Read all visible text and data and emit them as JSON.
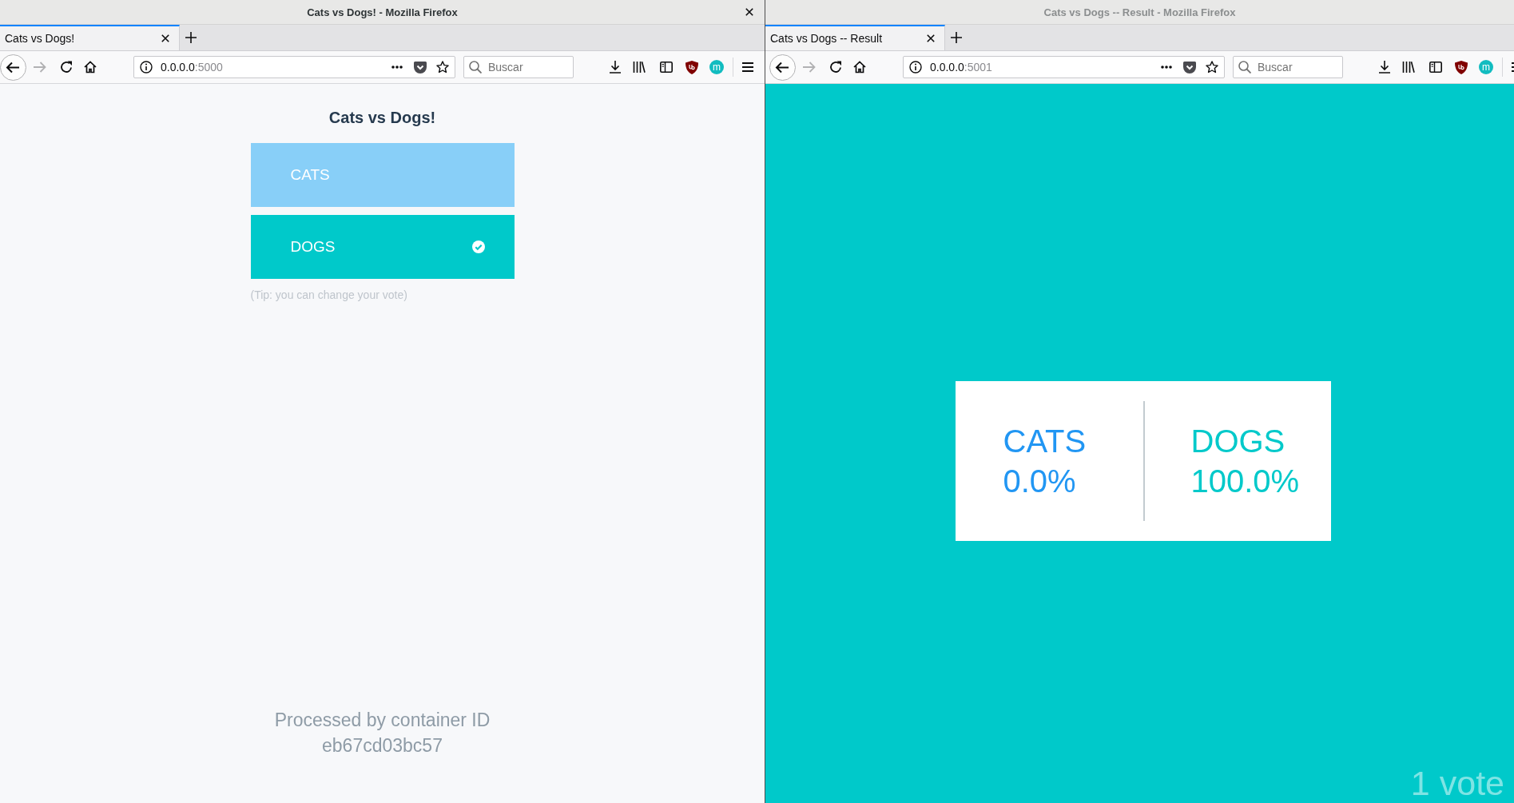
{
  "windows": [
    {
      "title": "Cats vs Dogs! - Mozilla Firefox",
      "active": true,
      "close_button": true,
      "tabs": [
        {
          "label": "Cats vs Dogs!",
          "selected": true
        }
      ],
      "forward_disabled": true,
      "address": {
        "host": "0.0.0.0",
        "port": ":5000"
      },
      "search": {
        "placeholder": "Buscar"
      },
      "extension_label": "m",
      "page": {
        "kind": "vote",
        "title": "Cats vs Dogs!",
        "options": [
          {
            "label": "CATS",
            "selected": false,
            "color": "#88cff8"
          },
          {
            "label": "DOGS",
            "selected": true,
            "color": "#00c9ca"
          }
        ],
        "tip": "(Tip: you can change your vote)",
        "footer": "Processed by container ID eb67cd03bc57"
      }
    },
    {
      "title": "Cats vs Dogs -- Result - Mozilla Firefox",
      "active": false,
      "tabs": [
        {
          "label": "Cats vs Dogs -- Result",
          "selected": true
        }
      ],
      "forward_disabled": true,
      "address": {
        "host": "0.0.0.0",
        "port": ":5001"
      },
      "search": {
        "placeholder": "Buscar"
      },
      "extension_label": "m",
      "page": {
        "kind": "result",
        "results": [
          {
            "label": "CATS",
            "value": "0.0%",
            "color": "#2196f3"
          },
          {
            "label": "DOGS",
            "value": "100.0%",
            "color": "#00c9ca"
          }
        ],
        "votes": "1 vote"
      }
    }
  ]
}
